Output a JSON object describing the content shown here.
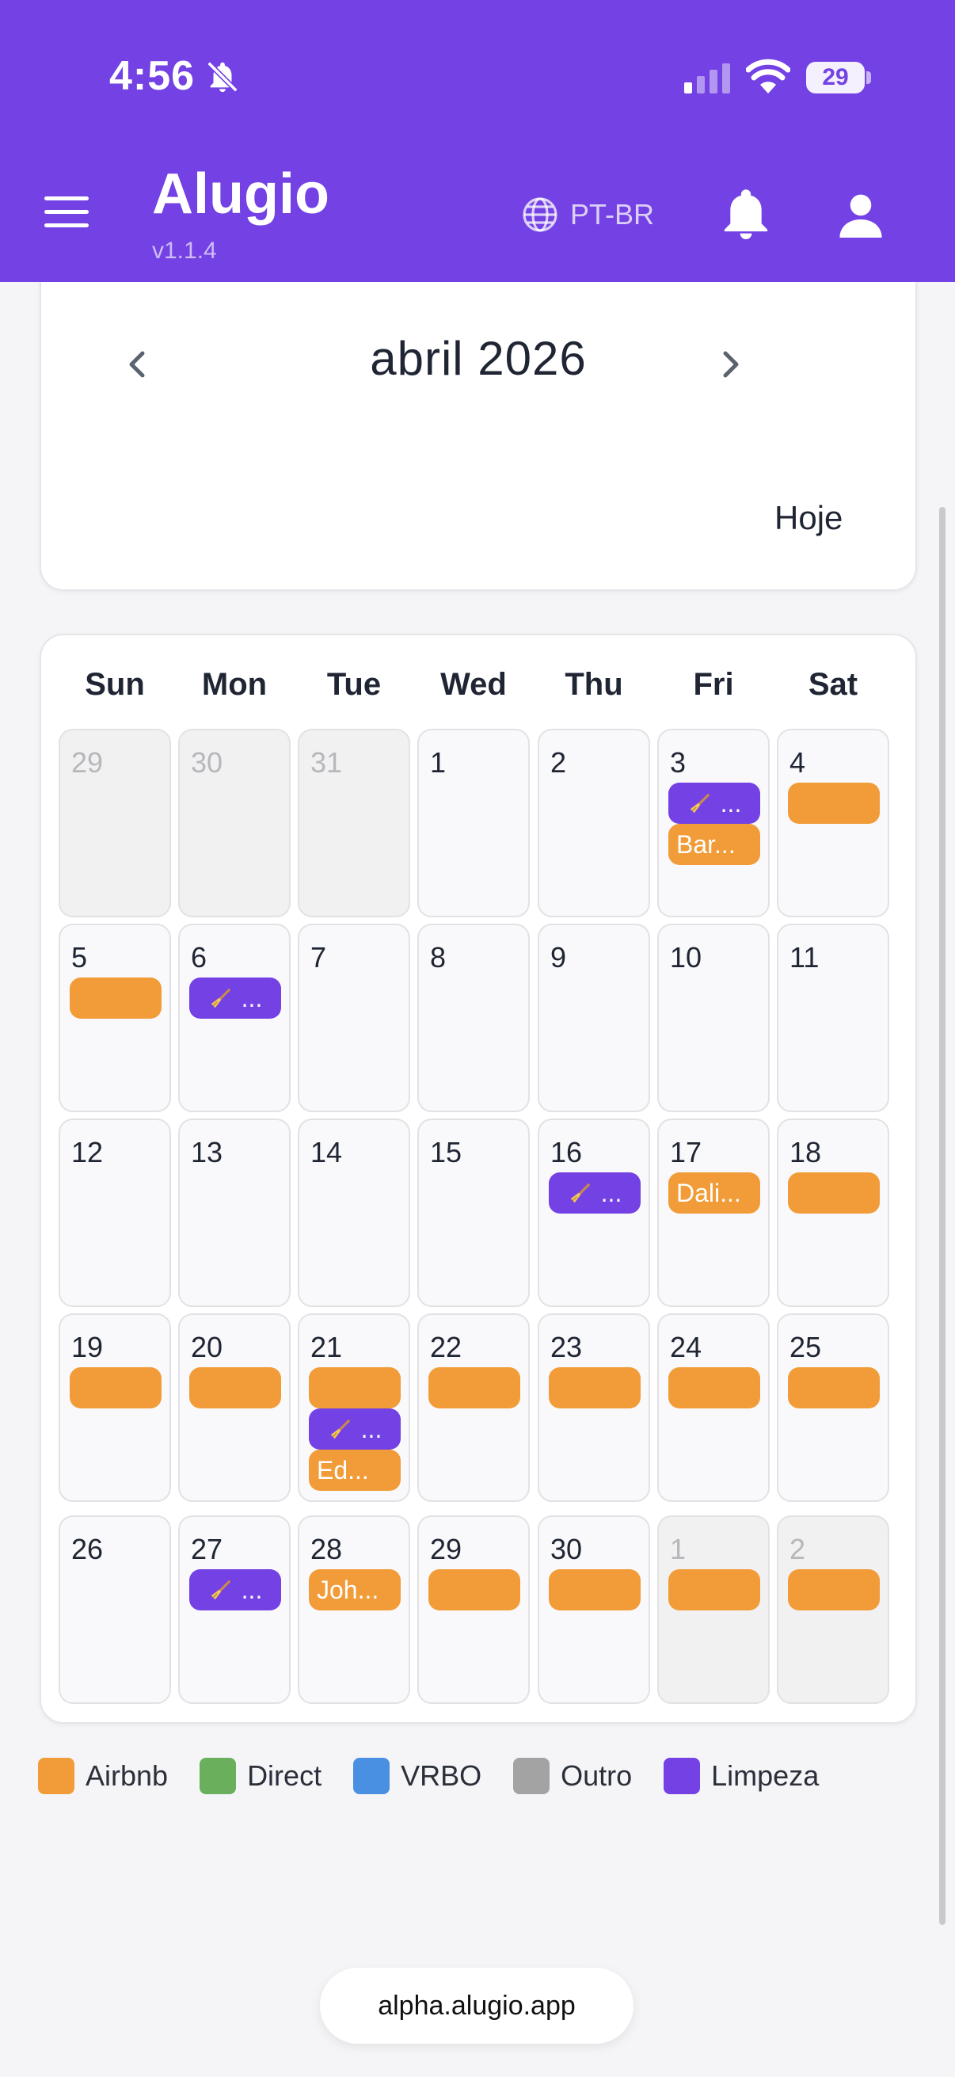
{
  "status_bar": {
    "time": "4:56",
    "battery": "29"
  },
  "header": {
    "title": "Alugio",
    "version": "v1.1.4",
    "language": "PT-BR"
  },
  "calendar_nav": {
    "month_label": "abril 2026",
    "today_label": "Hoje"
  },
  "calendar": {
    "weekdays": [
      "Sun",
      "Mon",
      "Tue",
      "Wed",
      "Thu",
      "Fri",
      "Sat"
    ],
    "weeks": [
      [
        {
          "day": "29",
          "other": true,
          "events": []
        },
        {
          "day": "30",
          "other": true,
          "events": []
        },
        {
          "day": "31",
          "other": true,
          "events": []
        },
        {
          "day": "1",
          "events": []
        },
        {
          "day": "2",
          "events": []
        },
        {
          "day": "3",
          "events": [
            {
              "type": "limpeza",
              "label": "..."
            },
            {
              "type": "airbnb",
              "label": "Bar..."
            }
          ]
        },
        {
          "day": "4",
          "events": [
            {
              "type": "airbnb",
              "label": ""
            }
          ]
        }
      ],
      [
        {
          "day": "5",
          "events": [
            {
              "type": "airbnb",
              "label": ""
            }
          ]
        },
        {
          "day": "6",
          "events": [
            {
              "type": "limpeza",
              "label": "..."
            }
          ]
        },
        {
          "day": "7",
          "events": []
        },
        {
          "day": "8",
          "events": []
        },
        {
          "day": "9",
          "events": []
        },
        {
          "day": "10",
          "events": []
        },
        {
          "day": "11",
          "events": []
        }
      ],
      [
        {
          "day": "12",
          "events": []
        },
        {
          "day": "13",
          "events": []
        },
        {
          "day": "14",
          "events": []
        },
        {
          "day": "15",
          "events": []
        },
        {
          "day": "16",
          "events": [
            {
              "type": "limpeza",
              "label": "..."
            }
          ]
        },
        {
          "day": "17",
          "events": [
            {
              "type": "airbnb",
              "label": "Dali..."
            }
          ]
        },
        {
          "day": "18",
          "events": [
            {
              "type": "airbnb",
              "label": ""
            }
          ]
        }
      ],
      [
        {
          "day": "19",
          "events": [
            {
              "type": "airbnb",
              "label": ""
            }
          ]
        },
        {
          "day": "20",
          "events": [
            {
              "type": "airbnb",
              "label": ""
            }
          ]
        },
        {
          "day": "21",
          "events": [
            {
              "type": "airbnb",
              "label": ""
            },
            {
              "type": "limpeza",
              "label": "..."
            },
            {
              "type": "airbnb",
              "label": "Ed..."
            }
          ]
        },
        {
          "day": "22",
          "events": [
            {
              "type": "airbnb",
              "label": ""
            }
          ]
        },
        {
          "day": "23",
          "events": [
            {
              "type": "airbnb",
              "label": ""
            }
          ]
        },
        {
          "day": "24",
          "events": [
            {
              "type": "airbnb",
              "label": ""
            }
          ]
        },
        {
          "day": "25",
          "events": [
            {
              "type": "airbnb",
              "label": ""
            }
          ]
        }
      ],
      [
        {
          "day": "26",
          "events": []
        },
        {
          "day": "27",
          "events": [
            {
              "type": "limpeza",
              "label": "..."
            }
          ]
        },
        {
          "day": "28",
          "events": [
            {
              "type": "airbnb",
              "label": "Joh..."
            }
          ]
        },
        {
          "day": "29",
          "events": [
            {
              "type": "airbnb",
              "label": ""
            }
          ]
        },
        {
          "day": "30",
          "events": [
            {
              "type": "airbnb",
              "label": ""
            }
          ]
        },
        {
          "day": "1",
          "other": true,
          "events": [
            {
              "type": "airbnb",
              "label": ""
            }
          ]
        },
        {
          "day": "2",
          "other": true,
          "events": [
            {
              "type": "airbnb",
              "label": ""
            }
          ]
        }
      ]
    ]
  },
  "legend": [
    {
      "label": "Airbnb",
      "color": "#f19c38"
    },
    {
      "label": "Direct",
      "color": "#6ab05c"
    },
    {
      "label": "VRBO",
      "color": "#4a90e2"
    },
    {
      "label": "Outro",
      "color": "#a3a3a3"
    },
    {
      "label": "Limpeza",
      "color": "#7341e4"
    }
  ],
  "browser": {
    "url": "alpha.alugio.app"
  }
}
